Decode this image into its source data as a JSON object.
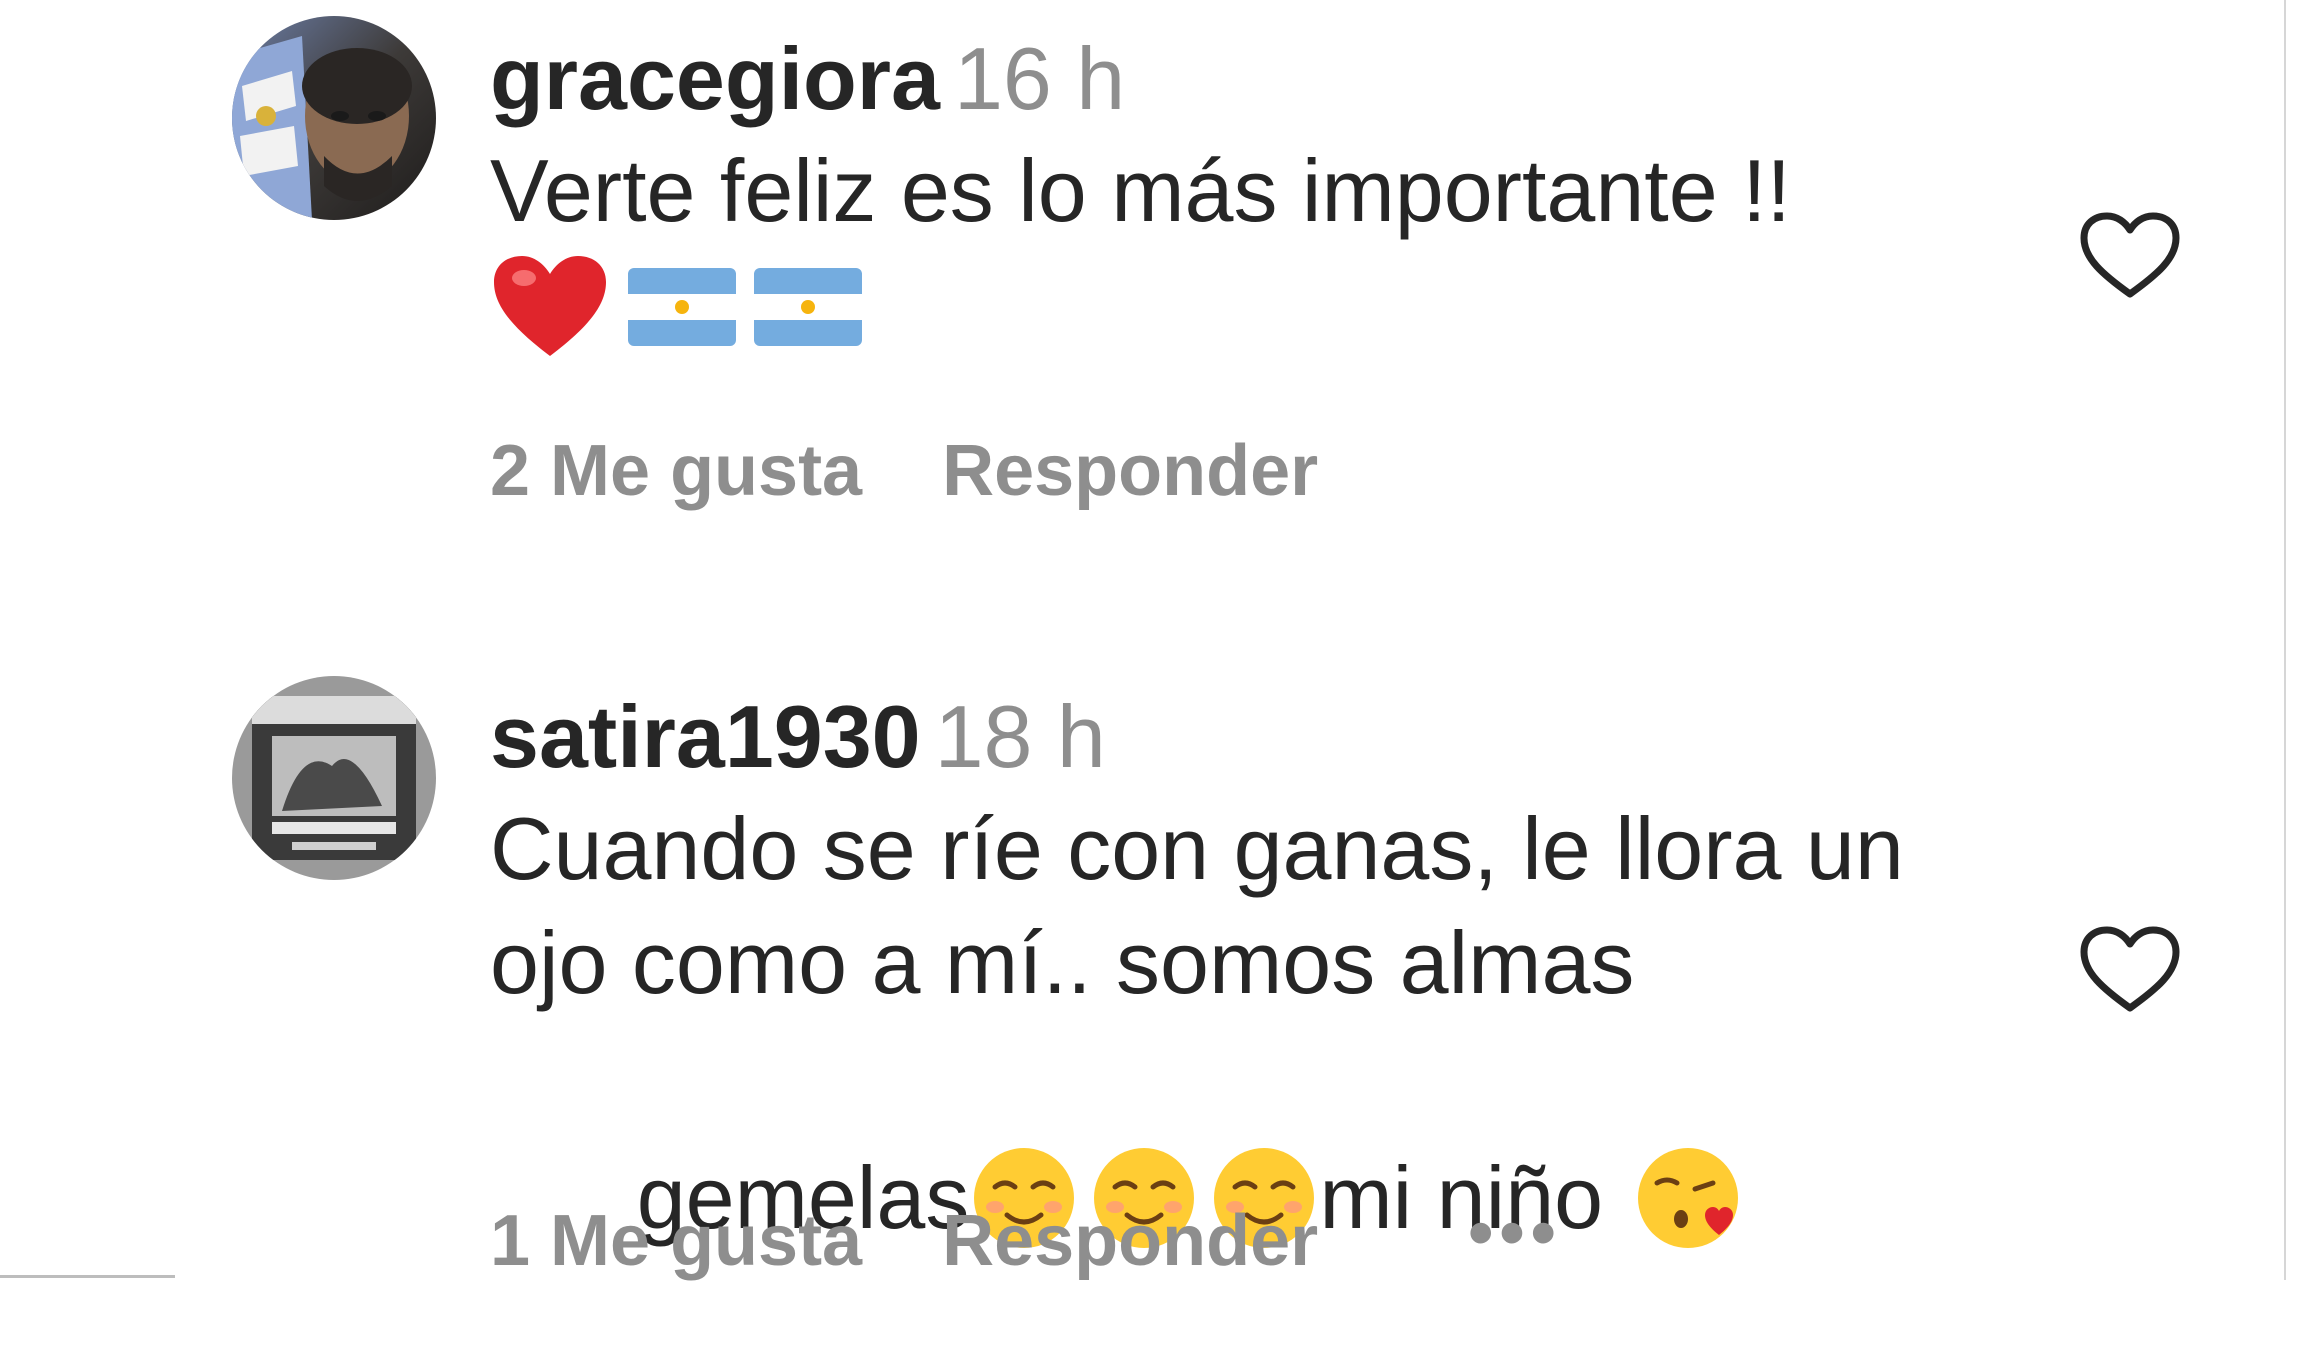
{
  "comments": [
    {
      "username": "gracegiora",
      "time": "16 h",
      "text": "Verte feliz es lo más importante !!",
      "emojis": [
        "red-heart",
        "argentina-flag",
        "argentina-flag"
      ],
      "likes_label": "2 Me gusta",
      "reply_label": "Responder"
    },
    {
      "username": "satira1930",
      "time": "18 h",
      "text_line1": "Cuando se ríe con ganas, le llora un",
      "text_line2": "ojo como a mí.. somos almas",
      "text_line3_a": "gemelas",
      "text_line3_b": "mi niño",
      "emojis": [
        "smiling-face",
        "smiling-face",
        "smiling-face",
        "kissing-heart-face"
      ],
      "likes_label": "1 Me gusta",
      "reply_label": "Responder",
      "more_label": "•••"
    }
  ],
  "colors": {
    "text": "#262626",
    "muted": "#8e8e8e",
    "heart_outline": "#262626"
  }
}
